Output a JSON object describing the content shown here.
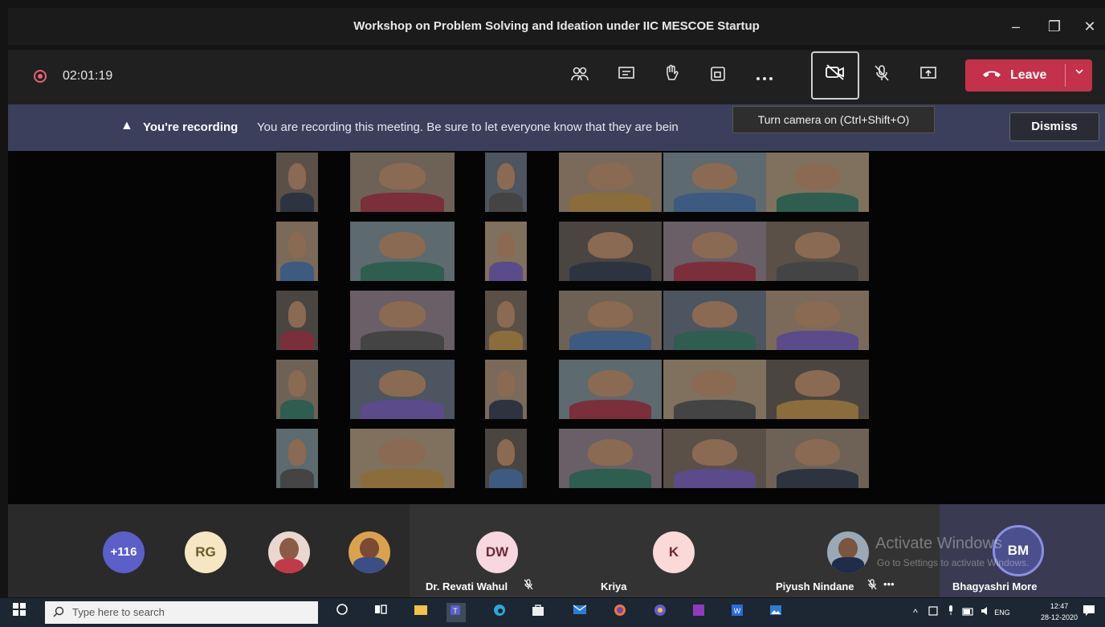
{
  "window": {
    "title": "Workshop on Problem Solving and Ideation under IIC MESCOE Startup",
    "minimize": "–",
    "maximize": "❐",
    "close": "✕"
  },
  "toolbar": {
    "timer": "02:01:19",
    "leave_label": "Leave"
  },
  "banner": {
    "warning_icon": "▲",
    "bold_text": "You're recording",
    "message": "You are recording this meeting. Be sure to let everyone know that they are bein",
    "dismiss_label": "Dismiss"
  },
  "tooltip": "Turn camera on (Ctrl+Shift+O)",
  "bottom_bar": {
    "overflow_count": "+116",
    "avatars": [
      {
        "initials": "RG"
      },
      {
        "initials": "DW",
        "name": "Dr. Revati Wahul"
      },
      {
        "initials": "K",
        "name": "Kriya"
      },
      {
        "name": "Piyush Nindane"
      },
      {
        "initials": "BM",
        "name": "Bhagyashri More"
      }
    ],
    "more": "•••"
  },
  "watermark": {
    "line1": "Activate Windows",
    "line2": "Go to Settings to activate Windows."
  },
  "taskbar": {
    "search_placeholder": "Type here to search",
    "lang": "ENG",
    "time": "12:47",
    "date": "28-12-2020"
  },
  "colors": {
    "leave": "#c4314b",
    "banner": "#3b3f5b",
    "record": "#e86276"
  }
}
